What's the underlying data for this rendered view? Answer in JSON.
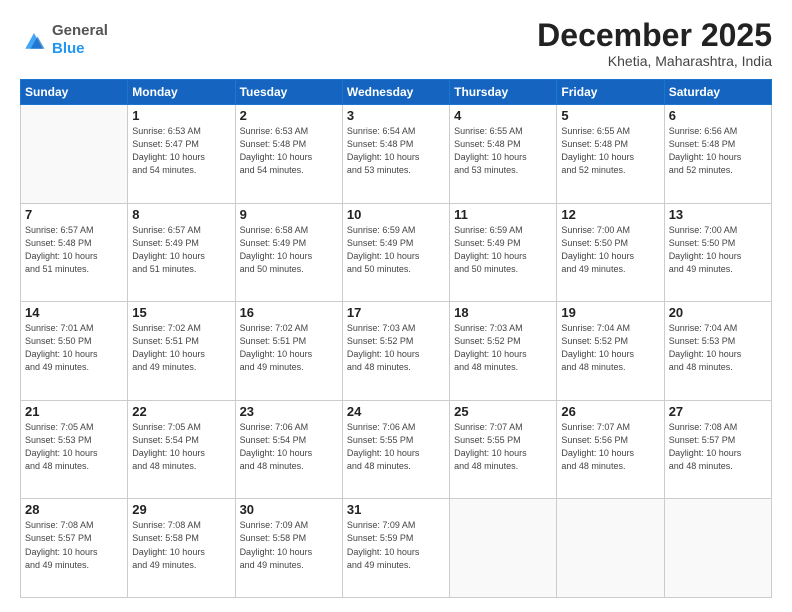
{
  "logo": {
    "general": "General",
    "blue": "Blue"
  },
  "header": {
    "month": "December 2025",
    "location": "Khetia, Maharashtra, India"
  },
  "days_of_week": [
    "Sunday",
    "Monday",
    "Tuesday",
    "Wednesday",
    "Thursday",
    "Friday",
    "Saturday"
  ],
  "weeks": [
    [
      {
        "day": "",
        "info": ""
      },
      {
        "day": "1",
        "info": "Sunrise: 6:53 AM\nSunset: 5:47 PM\nDaylight: 10 hours\nand 54 minutes."
      },
      {
        "day": "2",
        "info": "Sunrise: 6:53 AM\nSunset: 5:48 PM\nDaylight: 10 hours\nand 54 minutes."
      },
      {
        "day": "3",
        "info": "Sunrise: 6:54 AM\nSunset: 5:48 PM\nDaylight: 10 hours\nand 53 minutes."
      },
      {
        "day": "4",
        "info": "Sunrise: 6:55 AM\nSunset: 5:48 PM\nDaylight: 10 hours\nand 53 minutes."
      },
      {
        "day": "5",
        "info": "Sunrise: 6:55 AM\nSunset: 5:48 PM\nDaylight: 10 hours\nand 52 minutes."
      },
      {
        "day": "6",
        "info": "Sunrise: 6:56 AM\nSunset: 5:48 PM\nDaylight: 10 hours\nand 52 minutes."
      }
    ],
    [
      {
        "day": "7",
        "info": "Sunrise: 6:57 AM\nSunset: 5:48 PM\nDaylight: 10 hours\nand 51 minutes."
      },
      {
        "day": "8",
        "info": "Sunrise: 6:57 AM\nSunset: 5:49 PM\nDaylight: 10 hours\nand 51 minutes."
      },
      {
        "day": "9",
        "info": "Sunrise: 6:58 AM\nSunset: 5:49 PM\nDaylight: 10 hours\nand 50 minutes."
      },
      {
        "day": "10",
        "info": "Sunrise: 6:59 AM\nSunset: 5:49 PM\nDaylight: 10 hours\nand 50 minutes."
      },
      {
        "day": "11",
        "info": "Sunrise: 6:59 AM\nSunset: 5:49 PM\nDaylight: 10 hours\nand 50 minutes."
      },
      {
        "day": "12",
        "info": "Sunrise: 7:00 AM\nSunset: 5:50 PM\nDaylight: 10 hours\nand 49 minutes."
      },
      {
        "day": "13",
        "info": "Sunrise: 7:00 AM\nSunset: 5:50 PM\nDaylight: 10 hours\nand 49 minutes."
      }
    ],
    [
      {
        "day": "14",
        "info": "Sunrise: 7:01 AM\nSunset: 5:50 PM\nDaylight: 10 hours\nand 49 minutes."
      },
      {
        "day": "15",
        "info": "Sunrise: 7:02 AM\nSunset: 5:51 PM\nDaylight: 10 hours\nand 49 minutes."
      },
      {
        "day": "16",
        "info": "Sunrise: 7:02 AM\nSunset: 5:51 PM\nDaylight: 10 hours\nand 49 minutes."
      },
      {
        "day": "17",
        "info": "Sunrise: 7:03 AM\nSunset: 5:52 PM\nDaylight: 10 hours\nand 48 minutes."
      },
      {
        "day": "18",
        "info": "Sunrise: 7:03 AM\nSunset: 5:52 PM\nDaylight: 10 hours\nand 48 minutes."
      },
      {
        "day": "19",
        "info": "Sunrise: 7:04 AM\nSunset: 5:52 PM\nDaylight: 10 hours\nand 48 minutes."
      },
      {
        "day": "20",
        "info": "Sunrise: 7:04 AM\nSunset: 5:53 PM\nDaylight: 10 hours\nand 48 minutes."
      }
    ],
    [
      {
        "day": "21",
        "info": "Sunrise: 7:05 AM\nSunset: 5:53 PM\nDaylight: 10 hours\nand 48 minutes."
      },
      {
        "day": "22",
        "info": "Sunrise: 7:05 AM\nSunset: 5:54 PM\nDaylight: 10 hours\nand 48 minutes."
      },
      {
        "day": "23",
        "info": "Sunrise: 7:06 AM\nSunset: 5:54 PM\nDaylight: 10 hours\nand 48 minutes."
      },
      {
        "day": "24",
        "info": "Sunrise: 7:06 AM\nSunset: 5:55 PM\nDaylight: 10 hours\nand 48 minutes."
      },
      {
        "day": "25",
        "info": "Sunrise: 7:07 AM\nSunset: 5:55 PM\nDaylight: 10 hours\nand 48 minutes."
      },
      {
        "day": "26",
        "info": "Sunrise: 7:07 AM\nSunset: 5:56 PM\nDaylight: 10 hours\nand 48 minutes."
      },
      {
        "day": "27",
        "info": "Sunrise: 7:08 AM\nSunset: 5:57 PM\nDaylight: 10 hours\nand 48 minutes."
      }
    ],
    [
      {
        "day": "28",
        "info": "Sunrise: 7:08 AM\nSunset: 5:57 PM\nDaylight: 10 hours\nand 49 minutes."
      },
      {
        "day": "29",
        "info": "Sunrise: 7:08 AM\nSunset: 5:58 PM\nDaylight: 10 hours\nand 49 minutes."
      },
      {
        "day": "30",
        "info": "Sunrise: 7:09 AM\nSunset: 5:58 PM\nDaylight: 10 hours\nand 49 minutes."
      },
      {
        "day": "31",
        "info": "Sunrise: 7:09 AM\nSunset: 5:59 PM\nDaylight: 10 hours\nand 49 minutes."
      },
      {
        "day": "",
        "info": ""
      },
      {
        "day": "",
        "info": ""
      },
      {
        "day": "",
        "info": ""
      }
    ]
  ]
}
